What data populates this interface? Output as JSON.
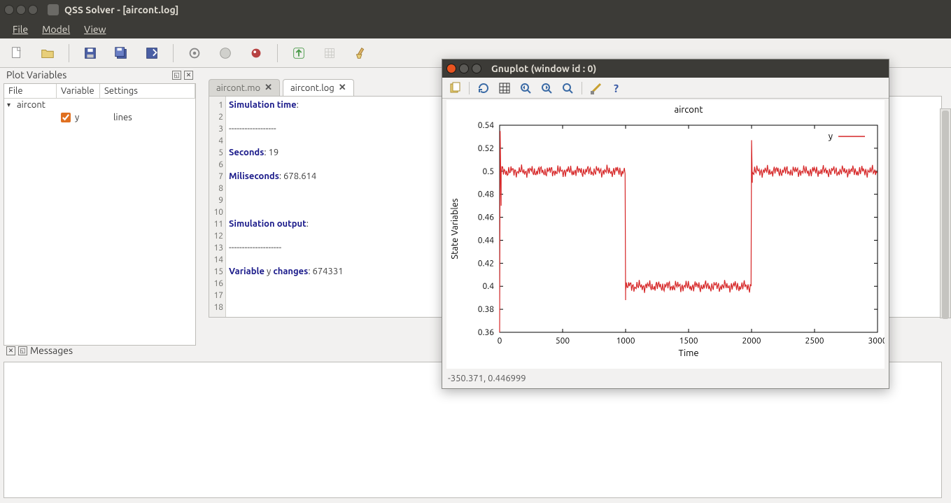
{
  "titlebar": {
    "title": "QSS Solver - [aircont.log]"
  },
  "menubar": {
    "file": "File",
    "model": "Model",
    "view": "View"
  },
  "plotvars": {
    "title": "Plot Variables",
    "headers": {
      "file": "File",
      "variable": "Variable",
      "settings": "Settings"
    },
    "root_label": "aircont",
    "var_label": "y",
    "settings_label": "lines"
  },
  "tabs": {
    "mo": "aircont.mo",
    "log": "aircont.log"
  },
  "log_lines": {
    "l1a": "Simulation time",
    "l1b": ":",
    "l3": "------------------",
    "l5a": "Seconds",
    "l5b": ": 19",
    "l7a": "Miliseconds",
    "l7b": ": 678.614",
    "l11a": "Simulation output",
    "l11b": ":",
    "l13": "--------------------",
    "l15a": "Variable ",
    "l15b": "y",
    "l15c": " changes",
    "l15d": ": 674331"
  },
  "messages": {
    "title": "Messages"
  },
  "gnuplot": {
    "title": "Gnuplot (window id : 0)",
    "status": "-350.371,  0.446999"
  },
  "chart_data": {
    "type": "line",
    "title": "aircont",
    "xlabel": "Time",
    "ylabel": "State Variables",
    "xlim": [
      0,
      3000
    ],
    "ylim": [
      0.36,
      0.54
    ],
    "x_ticks": [
      0,
      500,
      1000,
      1500,
      2000,
      2500,
      3000
    ],
    "y_ticks": [
      0.36,
      0.38,
      0.4,
      0.42,
      0.44,
      0.46,
      0.48,
      0.5,
      0.52,
      0.54
    ],
    "series": [
      {
        "name": "y",
        "color": "#d62728",
        "segments_approx": [
          {
            "x_range": [
              0,
              10
            ],
            "y_start": 0.36,
            "y_end": 0.535
          },
          {
            "x_range": [
              10,
              1000
            ],
            "y_mean": 0.5,
            "noise_amp": 0.006
          },
          {
            "x_range": [
              1000,
              2000
            ],
            "y_mean": 0.4,
            "noise_amp": 0.006
          },
          {
            "x_range": [
              2000,
              2010
            ],
            "y_start": 0.4,
            "y_end": 0.527
          },
          {
            "x_range": [
              2010,
              3000
            ],
            "y_mean": 0.5,
            "noise_amp": 0.006
          }
        ]
      }
    ],
    "legend": {
      "position": "top-right",
      "entries": [
        "y"
      ]
    }
  }
}
